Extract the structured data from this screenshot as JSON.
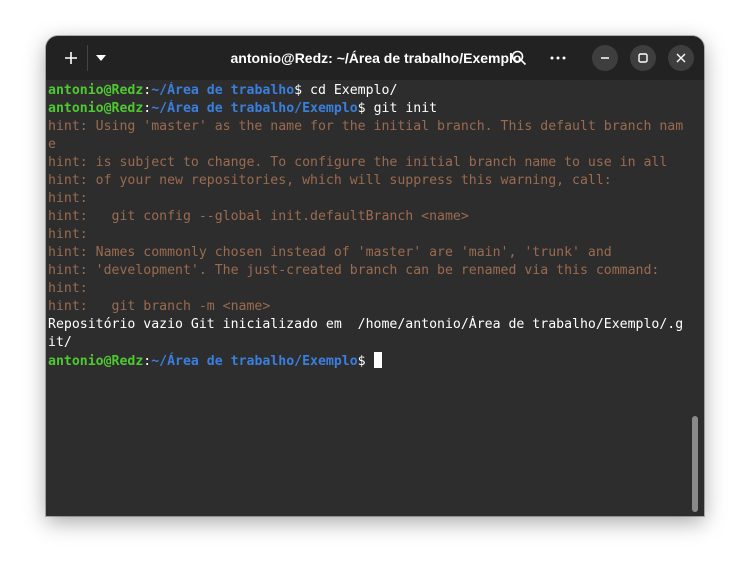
{
  "window": {
    "title": "antonio@Redz: ~/Área de trabalho/Exemplo"
  },
  "icons": {
    "new_tab": "plus-icon",
    "menu": "chevron-down-icon",
    "search": "search-icon",
    "more": "more-icon",
    "minimize": "minimize-icon",
    "maximize": "maximize-icon",
    "close": "close-icon"
  },
  "colors": {
    "prompt_user": "#4ec931",
    "prompt_path": "#3a7fde",
    "hint_text": "#9a6b4f",
    "background": "#2d2d2d",
    "titlebar": "#222222"
  },
  "terminal": {
    "prompt1": {
      "user": "antonio@Redz",
      "colon": ":",
      "path": "~/Área de trabalho",
      "dollar": "$",
      "command": " cd Exemplo/"
    },
    "prompt2": {
      "user": "antonio@Redz",
      "colon": ":",
      "path": "~/Área de trabalho/Exemplo",
      "dollar": "$",
      "command": " git init"
    },
    "output": [
      "hint: Using 'master' as the name for the initial branch. This default branch nam",
      "e",
      "hint: is subject to change. To configure the initial branch name to use in all",
      "hint: of your new repositories, which will suppress this warning, call:",
      "hint:",
      "hint:   git config --global init.defaultBranch <name>",
      "hint:",
      "hint: Names commonly chosen instead of 'master' are 'main', 'trunk' and",
      "hint: 'development'. The just-created branch can be renamed via this command:",
      "hint:",
      "hint:   git branch -m <name>",
      "Repositório vazio Git inicializado em  /home/antonio/Área de trabalho/Exemplo/.g",
      "it/"
    ],
    "prompt3": {
      "user": "antonio@Redz",
      "colon": ":",
      "path": "~/Área de trabalho/Exemplo",
      "dollar": "$",
      "command": " "
    }
  }
}
